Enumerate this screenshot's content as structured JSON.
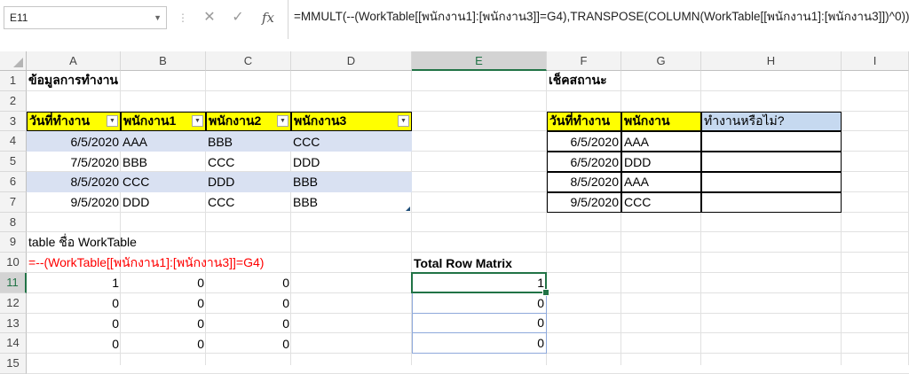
{
  "formula_bar": {
    "name_box": "E11",
    "cancel_icon": "✕",
    "enter_icon": "✓",
    "fx_label": "fx",
    "formula": "=MMULT(--(WorkTable[[พนักงาน1]:[พนักงาน3]]=G4),TRANSPOSE(COLUMN(WorkTable[[พนักงาน1]:[พนักงาน3]])^0))"
  },
  "columns": [
    "A",
    "B",
    "C",
    "D",
    "E",
    "F",
    "G",
    "H",
    "I"
  ],
  "rows": [
    "1",
    "2",
    "3",
    "4",
    "5",
    "6",
    "7",
    "8",
    "9",
    "10",
    "11",
    "12",
    "13",
    "14",
    "15"
  ],
  "selected_column": "E",
  "selected_row": "11",
  "left_section": {
    "title": "ข้อมูลการทำงาน",
    "headers": [
      "วันที่ทำงาน",
      "พนักงาน1",
      "พนักงาน2",
      "พนักงาน3"
    ],
    "rows": [
      [
        "6/5/2020",
        "AAA",
        "BBB",
        "CCC"
      ],
      [
        "7/5/2020",
        "BBB",
        "CCC",
        "DDD"
      ],
      [
        "8/5/2020",
        "CCC",
        "DDD",
        "BBB"
      ],
      [
        "9/5/2020",
        "DDD",
        "CCC",
        "BBB"
      ]
    ],
    "table_note": "table ชื่อ WorkTable",
    "matrix_formula": "=--(WorkTable[[พนักงาน1]:[พนักงาน3]]=G4)",
    "matrix": [
      [
        "1",
        "0",
        "0"
      ],
      [
        "0",
        "0",
        "0"
      ],
      [
        "0",
        "0",
        "0"
      ],
      [
        "0",
        "0",
        "0"
      ]
    ]
  },
  "middle_section": {
    "title": "Total Row Matrix",
    "values": [
      "1",
      "0",
      "0",
      "0"
    ]
  },
  "right_section": {
    "title": "เช็คสถานะ",
    "headers": [
      "วันที่ทำงาน",
      "พนักงาน",
      "ทำงานหรือไม่?"
    ],
    "rows": [
      [
        "6/5/2020",
        "AAA",
        ""
      ],
      [
        "6/5/2020",
        "DDD",
        ""
      ],
      [
        "8/5/2020",
        "AAA",
        ""
      ],
      [
        "9/5/2020",
        "CCC",
        ""
      ]
    ]
  },
  "colors": {
    "header_yellow": "#ffff00",
    "band_blue": "#d9e1f2",
    "status_header_blue": "#c6d9f0",
    "formula_red": "#ff0000",
    "excel_green": "#217346"
  }
}
